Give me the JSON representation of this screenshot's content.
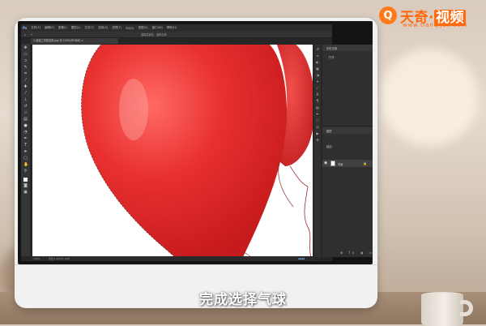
{
  "logo": {
    "badge_glyph": "Q",
    "brand_tianqi": "天奇",
    "brand_dot": "·",
    "brand_shipin": "视频",
    "url": "www.tianqijun.com"
  },
  "photoshop": {
    "app_icon": "Ps",
    "menu": [
      "文件(F)",
      "编辑(E)",
      "图像(I)",
      "图层(L)",
      "文字(Y)",
      "选择(S)",
      "滤镜(T)",
      "3D(D)",
      "视图(V)",
      "窗口(W)",
      "帮助(H)"
    ],
    "options_center": "选择并遮住 · 选择主体",
    "doc_tab": "1-创建工具的应用.jpg @ 100%(RGB/8) ×",
    "status_zoom": "100%",
    "status_doc": "文档:1.40M/1.40M",
    "panels": {
      "history_label": "历史记录",
      "history_item": "打开",
      "layers_label": "图层",
      "layer_name": "背景",
      "lock_label": "锁定:"
    }
  },
  "subtitle": "完成选择气球",
  "colors": {
    "balloon_red": "#e8302f",
    "logo_orange": "#ff6a10",
    "screen_bg": "#262626"
  }
}
